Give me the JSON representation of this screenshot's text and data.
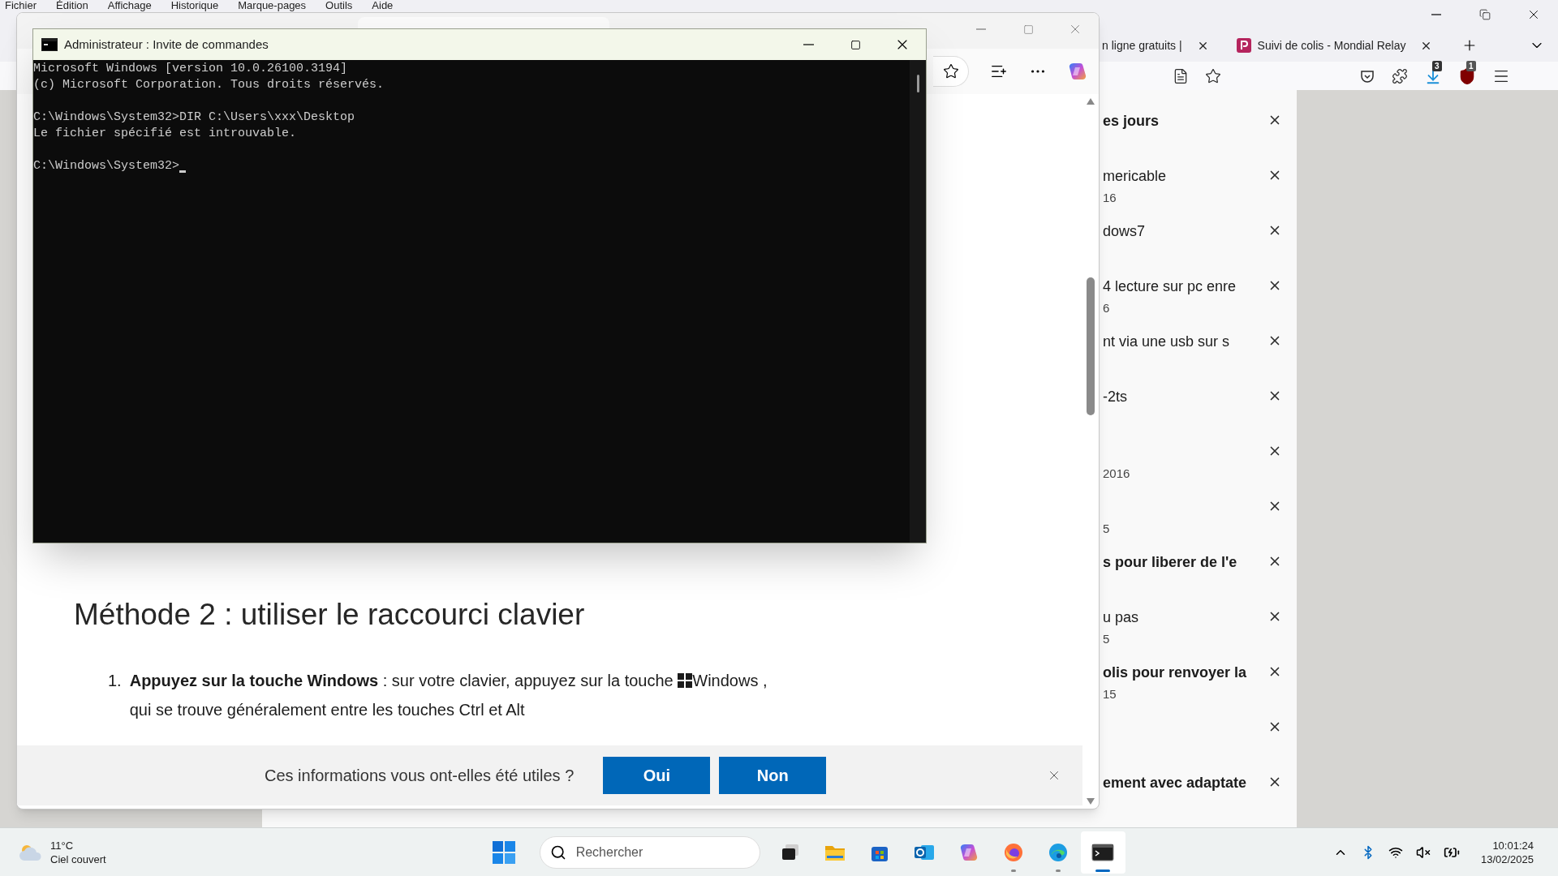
{
  "firefox": {
    "menu": [
      "Fichier",
      "Édition",
      "Affichage",
      "Historique",
      "Marque-pages",
      "Outils",
      "Aide"
    ],
    "tabs": [
      {
        "title": "n ligne gratuits |",
        "favicon": false
      },
      {
        "title": "Suivi de colis - Mondial Relay",
        "favicon": true
      }
    ],
    "extension_badges": [
      "3",
      "1"
    ],
    "list": [
      {
        "title": "es jours",
        "unread": true,
        "removable": true
      },
      {
        "title": "mericable",
        "subtitle": "16",
        "unread": false,
        "removable": true
      },
      {
        "title": "dows7",
        "unread": false,
        "removable": true
      },
      {
        "title": "4 lecture sur pc enre",
        "subtitle": "6",
        "unread": false,
        "removable": true
      },
      {
        "title": "nt via une usb sur s",
        "unread": false,
        "removable": true
      },
      {
        "title": "-2ts",
        "unread": false,
        "removable": true
      },
      {
        "subtitle": "2016",
        "removable": true
      },
      {
        "subtitle": "5",
        "removable": true
      },
      {
        "title": "s pour liberer de l'e",
        "unread": true,
        "removable": true
      },
      {
        "title": "u pas",
        "subtitle": "5",
        "unread": false,
        "removable": true
      },
      {
        "title": "olis pour renvoyer la",
        "subtitle": "15",
        "unread": true,
        "removable": true
      },
      {
        "removable": true
      },
      {
        "title": "ement avec adaptate",
        "unread": true,
        "removable": true
      }
    ]
  },
  "edge": {
    "heading": "Méthode 2 : utiliser le raccourci clavier",
    "steps": [
      {
        "number": "1.",
        "text": "**Appuyez sur la touche Windows** : sur votre clavier, appuyez sur la touche ",
        "after_icon": "Windows ,",
        "continuation": "qui se trouve généralement entre les touches Ctrl et Alt"
      }
    ],
    "feedback": {
      "question": "Ces informations vous ont-elles été utiles ?",
      "buttons": [
        "Oui",
        "Non"
      ]
    }
  },
  "cmd": {
    "title": "Administrateur : Invite de commandes",
    "blocks": [
      [
        "Microsoft Windows [version 10.0.26100.3194]",
        "(c) Microsoft Corporation. Tous droits réservés."
      ],
      [
        "C:\\Windows\\System32>DIR C:\\Users\\xxx\\Desktop",
        "Le fichier spécifié est introuvable."
      ],
      [
        "C:\\Windows\\System32>"
      ]
    ]
  },
  "taskbar": {
    "weather": {
      "temperature": "11°C",
      "condition": "Ciel couvert"
    },
    "search": {
      "placeholder": "Rechercher"
    },
    "apps": [
      {
        "kind": "taskview",
        "running": false,
        "selected": false
      },
      {
        "kind": "explorer",
        "running": false,
        "selected": false
      },
      {
        "kind": "store",
        "running": false,
        "selected": false
      },
      {
        "kind": "outlook",
        "running": false,
        "selected": false
      },
      {
        "kind": "copilot",
        "running": false,
        "selected": false
      },
      {
        "kind": "firefox",
        "running": true,
        "selected": false
      },
      {
        "kind": "edge",
        "running": true,
        "selected": false
      },
      {
        "kind": "terminal",
        "running": true,
        "selected": true
      }
    ],
    "time": "10:01:24",
    "date": "13/02/2025"
  }
}
